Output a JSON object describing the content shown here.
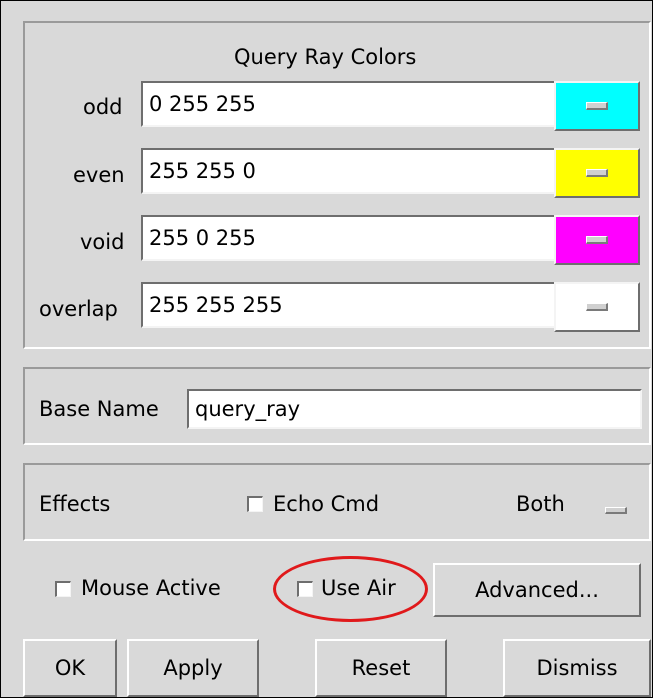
{
  "query_ray_colors": {
    "title": "Query Ray Colors",
    "rows": [
      {
        "label": "odd",
        "value": "0 255 255",
        "color": "#00ffff"
      },
      {
        "label": "even",
        "value": "255 255 0",
        "color": "#ffff00"
      },
      {
        "label": "void",
        "value": "255 0 255",
        "color": "#ff00ff"
      },
      {
        "label": "overlap",
        "value": "255 255 255",
        "color": "#ffffff"
      }
    ]
  },
  "base_name": {
    "label": "Base Name",
    "value": "query_ray"
  },
  "effects": {
    "label": "Effects",
    "echo_cmd_label": "Echo Cmd",
    "echo_cmd_checked": false,
    "mode_value": "Both"
  },
  "options": {
    "mouse_active_label": "Mouse Active",
    "mouse_active_checked": false,
    "use_air_label": "Use Air",
    "use_air_checked": false,
    "advanced_label": "Advanced..."
  },
  "buttons": {
    "ok": "OK",
    "apply": "Apply",
    "reset": "Reset",
    "dismiss": "Dismiss"
  },
  "colors": {
    "background": "#d9d9d9",
    "highlight_ellipse": "#e0191b"
  }
}
